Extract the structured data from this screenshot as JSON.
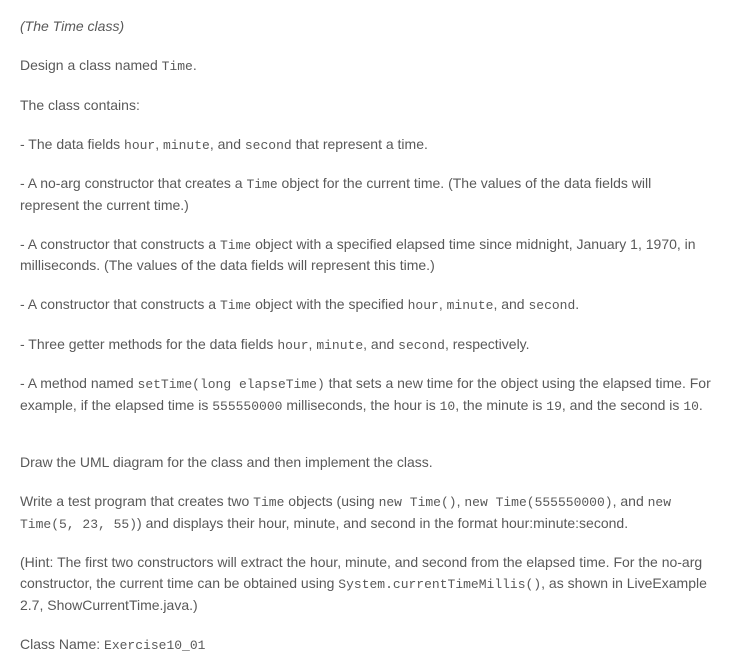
{
  "title": "(The Time class)",
  "intro_pre": "Design a class named ",
  "intro_code": "Time",
  "intro_post": ".",
  "contains": "The class contains:",
  "bullet1": {
    "pre": "- The data fields ",
    "c1": "hour",
    "sep1": ", ",
    "c2": "minute",
    "sep2": ", and ",
    "c3": "second",
    "post": " that represent a time."
  },
  "bullet2": {
    "pre": "- A no-arg constructor that creates a ",
    "c1": "Time",
    "post": " object for the current time. (The values of the data fields will represent the current time.)"
  },
  "bullet3": {
    "pre": "- A constructor that constructs a ",
    "c1": "Time",
    "post": " object with a specified elapsed time since midnight, January 1, 1970, in milliseconds. (The values of the data fields will represent this time.)"
  },
  "bullet4": {
    "pre": "- A constructor that constructs a ",
    "c1": "Time",
    "mid": " object with the specified ",
    "c2": "hour",
    "sep1": ", ",
    "c3": "minute",
    "sep2": ", and ",
    "c4": "second",
    "post": "."
  },
  "bullet5": {
    "pre": "- Three getter methods for the data fields ",
    "c1": "hour",
    "sep1": ", ",
    "c2": "minute",
    "sep2": ", and ",
    "c3": "second",
    "post": ", respectively."
  },
  "bullet6": {
    "pre": "- A method named ",
    "c1": "setTime(long elapseTime)",
    "mid1": " that sets a new time for the object using the elapsed time. For example, if the elapsed time is ",
    "c2": "555550000",
    "mid2": " milliseconds, the hour is ",
    "c3": "10",
    "mid3": ", the minute is ",
    "c4": "19",
    "mid4": ", and the second is ",
    "c5": "10",
    "post": "."
  },
  "draw": "Draw the UML diagram for the class and then implement the class.",
  "test": {
    "pre": "Write a test program that creates two ",
    "c1": "Time",
    "mid1": " objects (using ",
    "c2": "new Time()",
    "sep1": ", ",
    "c3": "new Time(555550000)",
    "sep2": ", and ",
    "c4": "new Time(5, 23, 55)",
    "post": ") and displays their hour, minute, and second in the format hour:minute:second."
  },
  "hint": {
    "pre": "(Hint: The first two constructors will extract the hour, minute, and second from the elapsed time. For the no-arg constructor, the current time can be obtained using ",
    "c1": "System.currentTimeMillis()",
    "post": ", as shown in LiveExample 2.7, ShowCurrentTime.java.)"
  },
  "classname": {
    "pre": "Class Name: ",
    "c1": "Exercise10_01"
  }
}
